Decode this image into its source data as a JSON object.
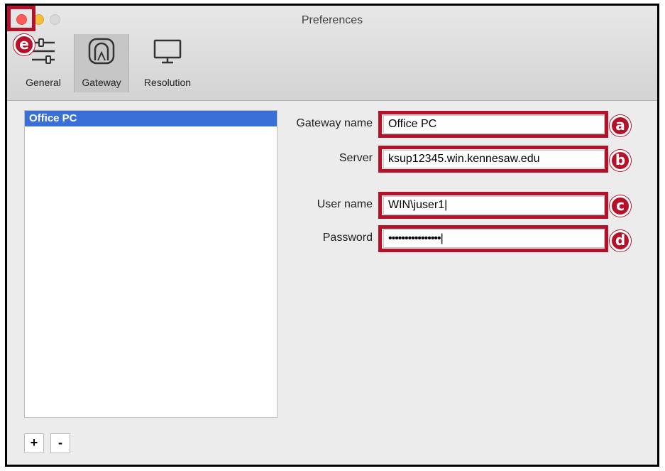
{
  "window": {
    "title": "Preferences"
  },
  "toolbar": {
    "buttons": [
      {
        "label": "General",
        "icon": "sliders-icon"
      },
      {
        "label": "Gateway",
        "icon": "gateway-tunnel-icon",
        "active": true
      },
      {
        "label": "Resolution",
        "icon": "monitor-icon"
      }
    ]
  },
  "sidebar": {
    "items": [
      {
        "label": "Office PC",
        "selected": true
      }
    ],
    "add_label": "+",
    "remove_label": "-"
  },
  "form": {
    "gateway_name": {
      "label": "Gateway name",
      "value": "Office PC"
    },
    "server": {
      "label": "Server",
      "value": "ksup12345.win.kennesaw.edu"
    },
    "user_name": {
      "label": "User name",
      "value": "WIN\\juser1|"
    },
    "password": {
      "label": "Password",
      "value": "••••••••••••••••|"
    }
  },
  "annotations": {
    "a": "a",
    "b": "b",
    "c": "c",
    "d": "d",
    "e": "e",
    "color": "#b5122a"
  }
}
